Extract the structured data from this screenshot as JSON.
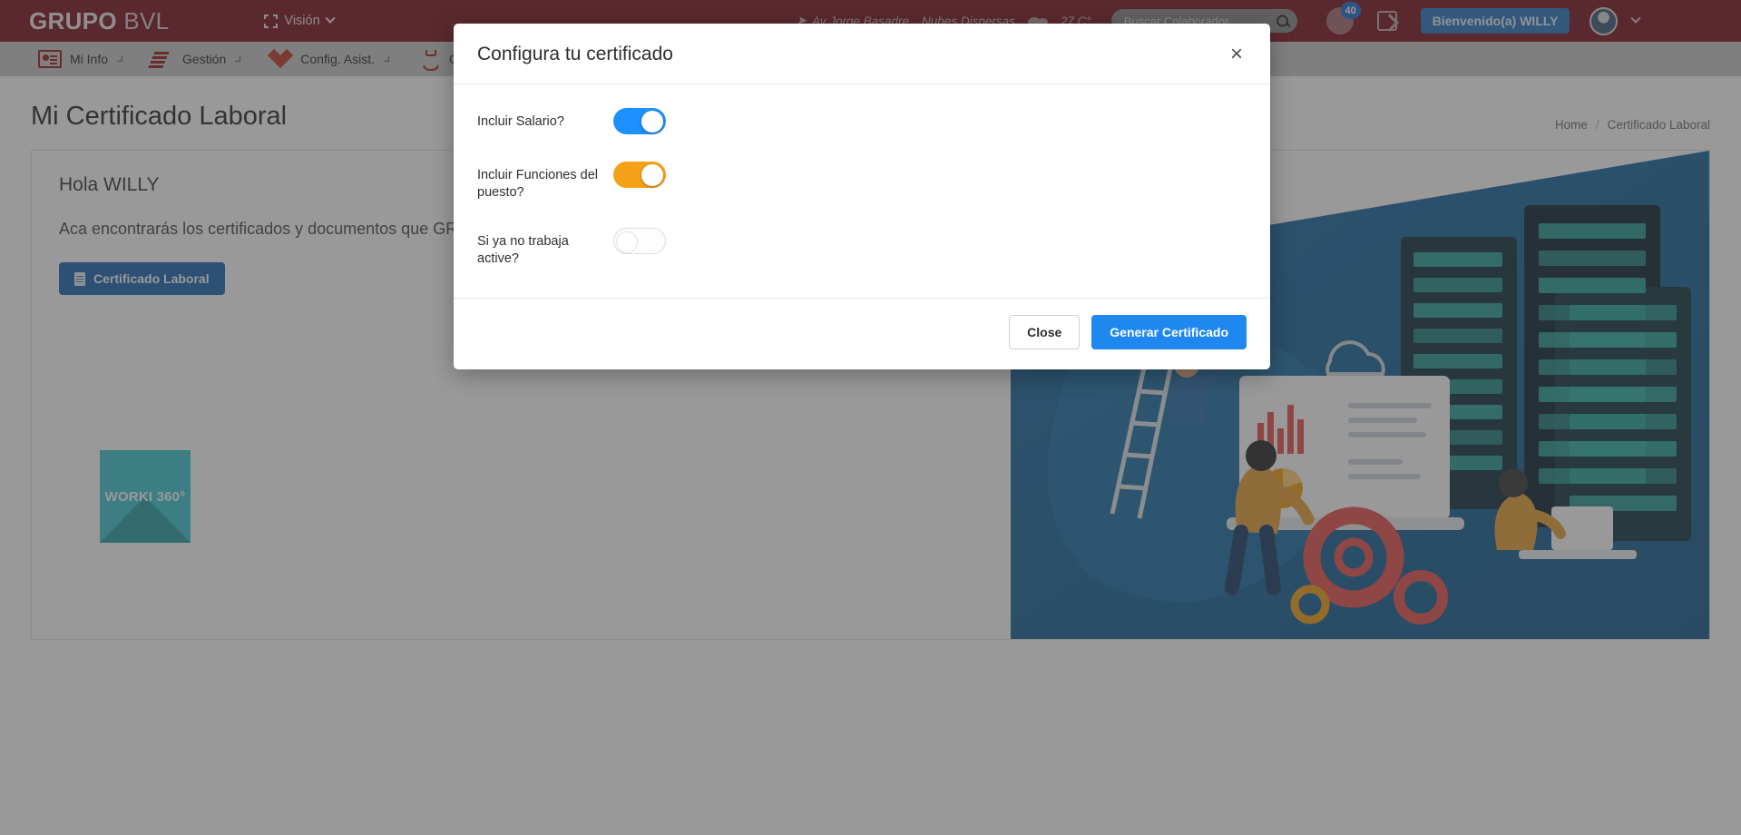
{
  "header": {
    "brand_bold": "GRUPO",
    "brand_light": "BVL",
    "vision_label": "Visión",
    "weather": {
      "location": "Av Jorge Basadre",
      "condition": "Nubes Dispersas",
      "temperature": "27 C°"
    },
    "search_placeholder": "Buscar Colaborador",
    "search_value": "",
    "notification_count": "40",
    "welcome_label": "Bienvenido(a) WILLY"
  },
  "nav": {
    "items": [
      {
        "label": "Mi Info",
        "icon": "id-card-icon"
      },
      {
        "label": "Gestión",
        "icon": "stack-icon"
      },
      {
        "label": "Config. Asist.",
        "icon": "diamonds-icon"
      },
      {
        "label": "Config.",
        "icon": "flask-icon"
      }
    ]
  },
  "page": {
    "title": "Mi Certificado Laboral",
    "breadcrumb": {
      "home": "Home",
      "separator": "/",
      "current": "Certificado Laboral"
    },
    "card": {
      "greeting": "Hola WILLY",
      "description": "Aca encontrarás los certificados y documentos que GR",
      "certificate_button": "Certificado Laboral",
      "worki_logo": "WORKI 360°"
    }
  },
  "modal": {
    "title": "Configura tu certificado",
    "close_icon": "×",
    "options": [
      {
        "label": "Incluir Salario?",
        "state": "on",
        "color": "#1e90ff"
      },
      {
        "label": "Incluir Funciones del puesto?",
        "state": "on",
        "color": "#f5a117"
      },
      {
        "label": "Si ya no trabaja active?",
        "state": "off",
        "color": "#ffffff"
      }
    ],
    "close_button": "Close",
    "submit_button": "Generar Certificado"
  },
  "colors": {
    "header_bg": "#7a1622",
    "nav_bg": "#c8c8c8",
    "primary_blue": "#1e88f0",
    "accent_orange": "#f5a117",
    "worki_teal": "#2b9fa8"
  }
}
